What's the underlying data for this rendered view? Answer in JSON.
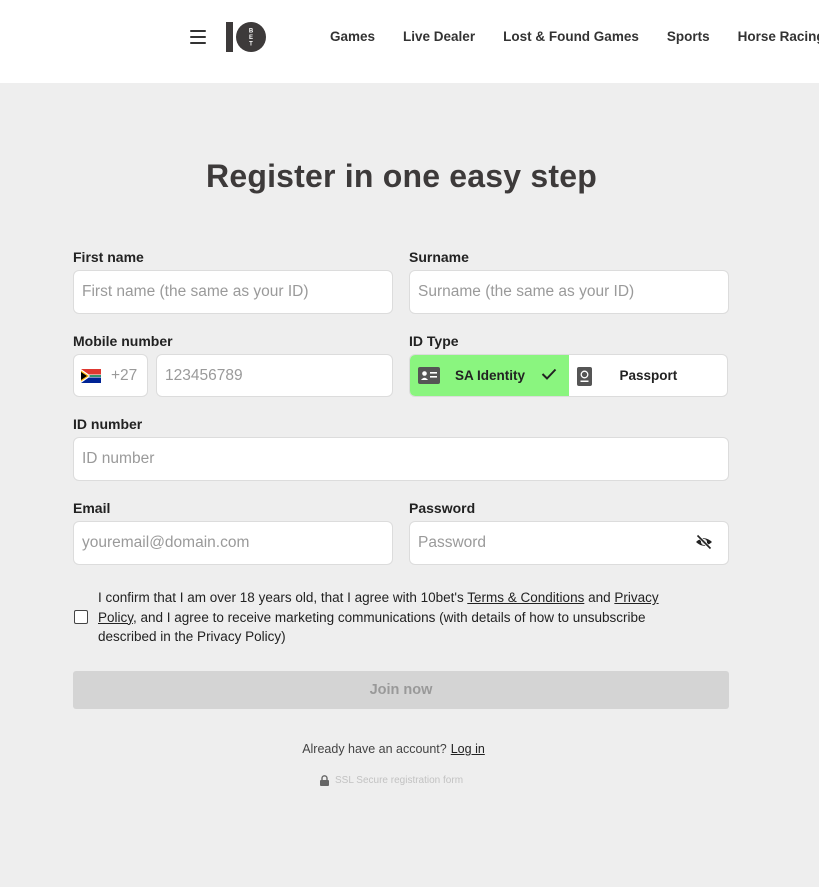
{
  "header": {
    "nav": [
      "Games",
      "Live Dealer",
      "Lost & Found Games",
      "Sports",
      "Horse Racing"
    ]
  },
  "page": {
    "title": "Register in one easy step"
  },
  "form": {
    "first_name": {
      "label": "First name",
      "placeholder": "First name (the same as your ID)",
      "value": ""
    },
    "surname": {
      "label": "Surname",
      "placeholder": "Surname (the same as your ID)",
      "value": ""
    },
    "mobile": {
      "label": "Mobile number",
      "country_code": "+27",
      "flag": "south-africa-flag",
      "placeholder": "123456789",
      "value": ""
    },
    "id_type": {
      "label": "ID Type",
      "options": [
        "SA Identity",
        "Passport"
      ],
      "selected": "SA Identity",
      "active_color": "#8af57f"
    },
    "id_number": {
      "label": "ID number",
      "placeholder": "ID number",
      "value": ""
    },
    "email": {
      "label": "Email",
      "placeholder": "youremail@domain.com",
      "value": ""
    },
    "password": {
      "label": "Password",
      "placeholder": "Password",
      "value": ""
    },
    "consent": {
      "checked": false,
      "text_1": "I confirm that I am over 18 years old, that I agree with 10bet's ",
      "terms_link": "Terms & Conditions",
      "text_2": " and ",
      "privacy_link": "Privacy Policy",
      "text_3": ", and I agree to receive marketing communications (with details of how to unsubscribe described in the Privacy Policy)"
    },
    "submit_label": "Join now"
  },
  "footer": {
    "already_text": "Already have an account?",
    "login_link": "Log in",
    "ssl_text": "SSL Secure registration form"
  }
}
